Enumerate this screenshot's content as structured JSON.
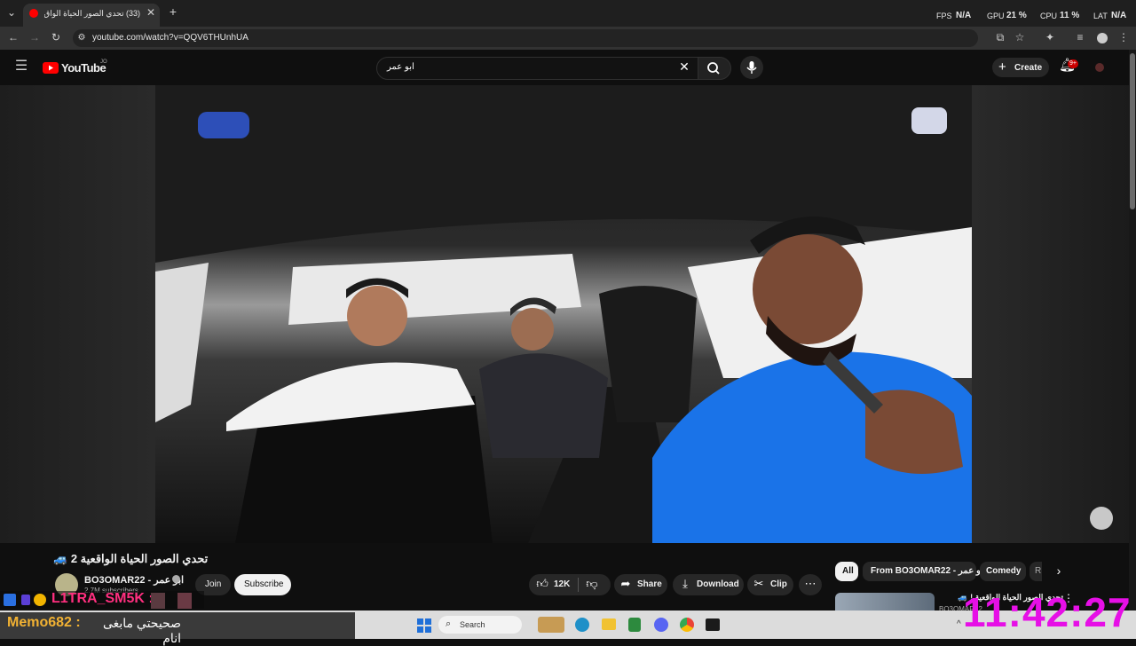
{
  "browser": {
    "tab_title": "(33) تحدي الصور الحياة الواق...",
    "url": "youtube.com/watch?v=QQV6THUnhUA",
    "overlay_stats": {
      "fps_label": "FPS",
      "fps_value": "N/A",
      "gpu_label": "GPU",
      "gpu_value": "21 %",
      "cpu_label": "CPU",
      "cpu_value": "11 %",
      "lat_label": "LAT",
      "lat_value": "N/A"
    }
  },
  "youtube": {
    "logo_text": "YouTube",
    "country_code": "JO",
    "search_query": "ابو عمر",
    "create_label": "Create",
    "notifications_badge": "9+"
  },
  "video": {
    "title": "تحدي الصور الحياة الواقعية 2 🚙",
    "channel_name": "BO3OMAR22 - ابو عمر",
    "subscribers": "2.7M subscribers",
    "join_label": "Join",
    "subscribe_label": "Subscribe",
    "likes": "12K",
    "share_label": "Share",
    "download_label": "Download",
    "clip_label": "Clip"
  },
  "chips": [
    "All",
    "From BO3OMAR22 - ابو عمر",
    "Comedy",
    "R"
  ],
  "recommendation": {
    "title": "تحدي الصور الحياة الواقعية ! 🚙",
    "channel": "BO3OMAR22"
  },
  "stream_overlay": {
    "donor_name": "L1TRA_SM5K :",
    "chat_user": "Memo682 :",
    "chat_message": "صحيحتي مابغى انام",
    "clock": "11:42:27"
  },
  "taskbar": {
    "search_label": "Search"
  },
  "colors": {
    "youtube_red": "#ff0000",
    "overlay_magenta": "#e60fe6",
    "donor_pink": "#ff2f7f"
  }
}
